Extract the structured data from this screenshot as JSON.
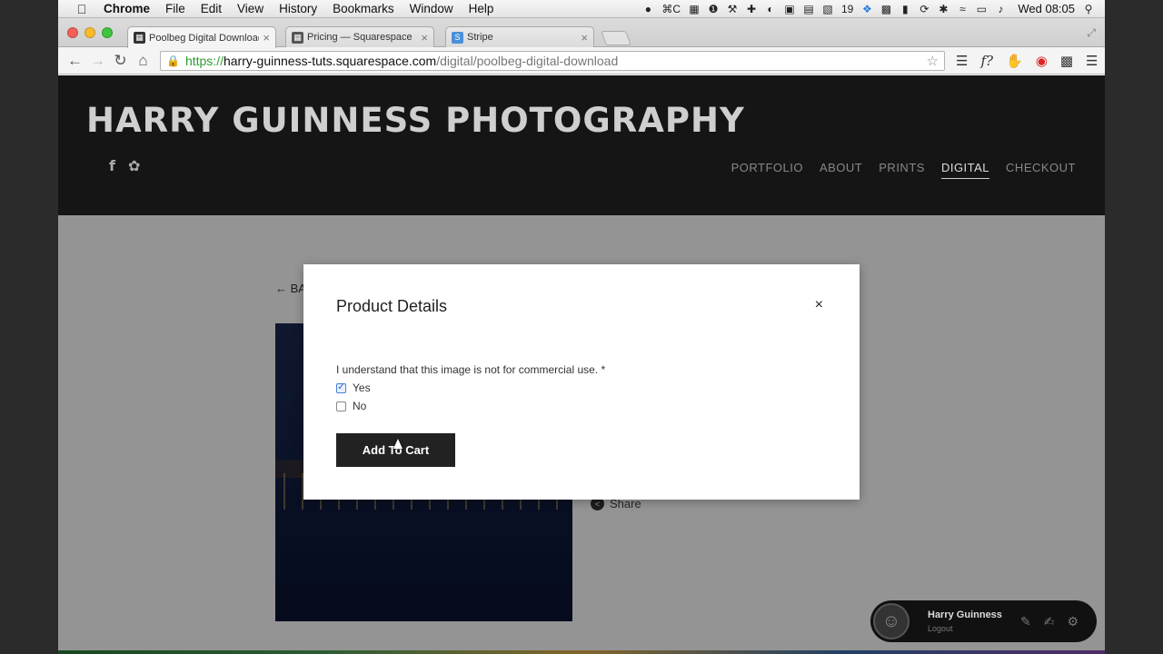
{
  "menubar": {
    "app": "Chrome",
    "menus": [
      "File",
      "Edit",
      "View",
      "History",
      "Bookmarks",
      "Window",
      "Help"
    ],
    "clock": "Wed 08:05",
    "status_icons": [
      "camera-icon",
      "cmd-c-icon",
      "box-icon",
      "one-icon",
      "wrench-icon",
      "plus-icon",
      "circle-icon",
      "video-icon",
      "dictionary-icon",
      "n-icon",
      "calendar-icon",
      "dropbox-icon",
      "g-icon",
      "display-icon",
      "time-machine-icon",
      "bluetooth-icon",
      "wifi-icon",
      "battery-icon",
      "volume-icon"
    ],
    "calendar_day": "19"
  },
  "tabs": [
    {
      "title": "Poolbeg Digital Download",
      "favicon": "squarespace-icon",
      "active": true
    },
    {
      "title": "Pricing — Squarespace",
      "favicon": "squarespace-icon",
      "active": false
    },
    {
      "title": "Stripe",
      "favicon": "stripe-icon",
      "favicon_letter": "S",
      "active": false
    }
  ],
  "address": {
    "scheme": "https://",
    "host": "harry-guinness-tuts.squarespace.com",
    "path": "/digital/poolbeg-digital-download"
  },
  "site": {
    "title": "HARRY GUINNESS PHOTOGRAPHY",
    "nav": [
      "PORTFOLIO",
      "ABOUT",
      "PRINTS",
      "DIGITAL",
      "CHECKOUT"
    ],
    "active_nav": "DIGITAL",
    "back_label": "← BA",
    "share_label": "Share"
  },
  "modal": {
    "title": "Product Details",
    "close_label": "×",
    "question": "I understand that this image is not for commercial use. *",
    "options": [
      {
        "label": "Yes",
        "checked": true
      },
      {
        "label": "No",
        "checked": false
      }
    ],
    "button_label": "Add To Cart"
  },
  "user": {
    "name": "Harry Guinness",
    "logout": "Logout"
  }
}
